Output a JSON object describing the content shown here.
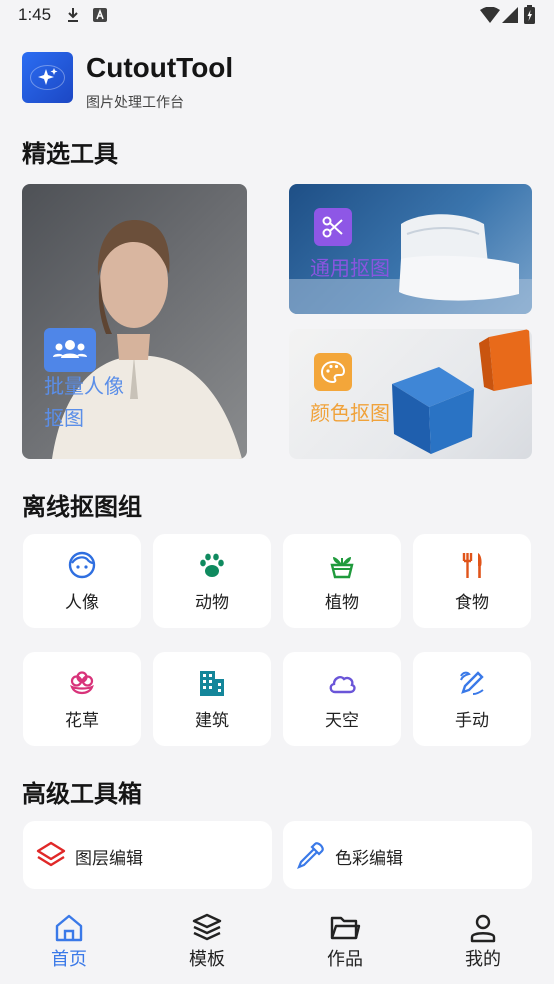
{
  "status_bar": {
    "time": "1:45"
  },
  "header": {
    "app_name": "CutoutTool",
    "subtitle": "图片处理工作台"
  },
  "featured": {
    "title": "精选工具",
    "batch": {
      "label_line1": "批量人像",
      "label_line2": "抠图",
      "icon": "group-icon"
    },
    "general": {
      "label": "通用抠图",
      "icon": "scissors-icon"
    },
    "color": {
      "label": "颜色抠图",
      "icon": "palette-icon"
    }
  },
  "offline": {
    "title": "离线抠图组",
    "items": [
      {
        "label": "人像",
        "icon": "face-icon",
        "color": "#2f6fe0"
      },
      {
        "label": "动物",
        "icon": "paw-icon",
        "color": "#0f8a5f"
      },
      {
        "label": "植物",
        "icon": "potted-plant-icon",
        "color": "#1f9a3c"
      },
      {
        "label": "食物",
        "icon": "cutlery-icon",
        "color": "#e0541a"
      },
      {
        "label": "花草",
        "icon": "flower-icon",
        "color": "#d8337a"
      },
      {
        "label": "建筑",
        "icon": "building-icon",
        "color": "#14869a"
      },
      {
        "label": "天空",
        "icon": "cloud-icon",
        "color": "#6a55d8"
      },
      {
        "label": "手动",
        "icon": "pen-icon",
        "color": "#3a79e8"
      }
    ]
  },
  "advanced": {
    "title": "高级工具箱",
    "items": [
      {
        "label": "图层编辑",
        "icon": "layers-icon",
        "color": "#e02828"
      },
      {
        "label": "色彩编辑",
        "icon": "eyedropper-icon",
        "color": "#3a79e8"
      }
    ]
  },
  "nav": {
    "items": [
      {
        "label": "首页",
        "icon": "home-icon",
        "active": true
      },
      {
        "label": "模板",
        "icon": "stack-icon",
        "active": false
      },
      {
        "label": "作品",
        "icon": "folder-icon",
        "active": false
      },
      {
        "label": "我的",
        "icon": "person-icon",
        "active": false
      }
    ]
  },
  "colors": {
    "accent": "#3a79e8",
    "background": "#f4f4f6",
    "card": "#ffffff"
  }
}
